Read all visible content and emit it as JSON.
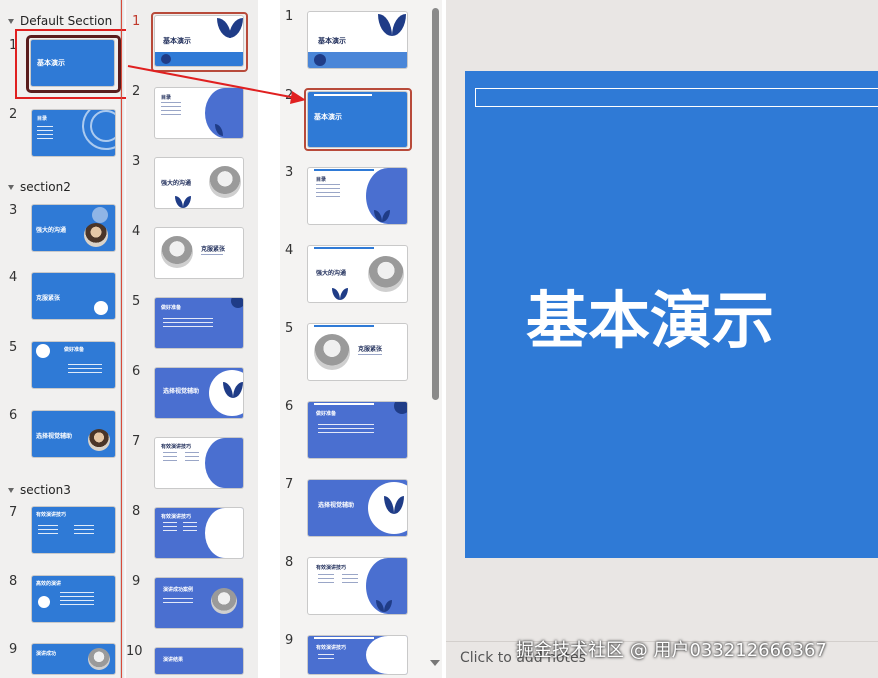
{
  "panel_a": {
    "sections": [
      {
        "label": "Default Section"
      },
      {
        "label": "section2"
      },
      {
        "label": "section3"
      }
    ],
    "slides": [
      {
        "num": "1",
        "title": "基本演示"
      },
      {
        "num": "2",
        "title": "目录"
      },
      {
        "num": "3",
        "title": "强大的沟通"
      },
      {
        "num": "4",
        "title": "克服紧张"
      },
      {
        "num": "5",
        "title": "做好准备"
      },
      {
        "num": "6",
        "title": "选择视觉辅助"
      },
      {
        "num": "7",
        "title": "有效演讲技巧"
      },
      {
        "num": "8",
        "title": "高效的演讲"
      },
      {
        "num": "9",
        "title": "演讲成功"
      }
    ]
  },
  "panel_b": {
    "slides": [
      {
        "num": "1",
        "title": "基本演示"
      },
      {
        "num": "2",
        "title": "目录"
      },
      {
        "num": "3",
        "title": "强大的沟通"
      },
      {
        "num": "4",
        "title": "克服紧张"
      },
      {
        "num": "5",
        "title": "做好准备"
      },
      {
        "num": "6",
        "title": "选择视觉辅助"
      },
      {
        "num": "7",
        "title": "有效演讲技巧"
      },
      {
        "num": "8",
        "title": "有效演讲技巧"
      },
      {
        "num": "9",
        "title": "演讲成功案例"
      },
      {
        "num": "10",
        "title": "演讲结果"
      }
    ]
  },
  "panel_c": {
    "slides": [
      {
        "num": "1",
        "title": "基本演示"
      },
      {
        "num": "2",
        "title": "基本演示"
      },
      {
        "num": "3",
        "title": "目录"
      },
      {
        "num": "4",
        "title": "强大的沟通"
      },
      {
        "num": "5",
        "title": "克服紧张"
      },
      {
        "num": "6",
        "title": "做好准备"
      },
      {
        "num": "7",
        "title": "选择视觉辅助"
      },
      {
        "num": "8",
        "title": "有效演讲技巧"
      },
      {
        "num": "9",
        "title": "有效演讲技巧"
      }
    ]
  },
  "editor": {
    "slide_title": "基本演示",
    "notes_placeholder": "Click to add notes"
  },
  "watermark": "掘金技术社区 @ 用户033212666367",
  "colors": {
    "slide_blue": "#2f7ad6",
    "dark_navy": "#1f3c87",
    "selection_red": "#e02020",
    "selection_brown": "#b84a3a"
  }
}
